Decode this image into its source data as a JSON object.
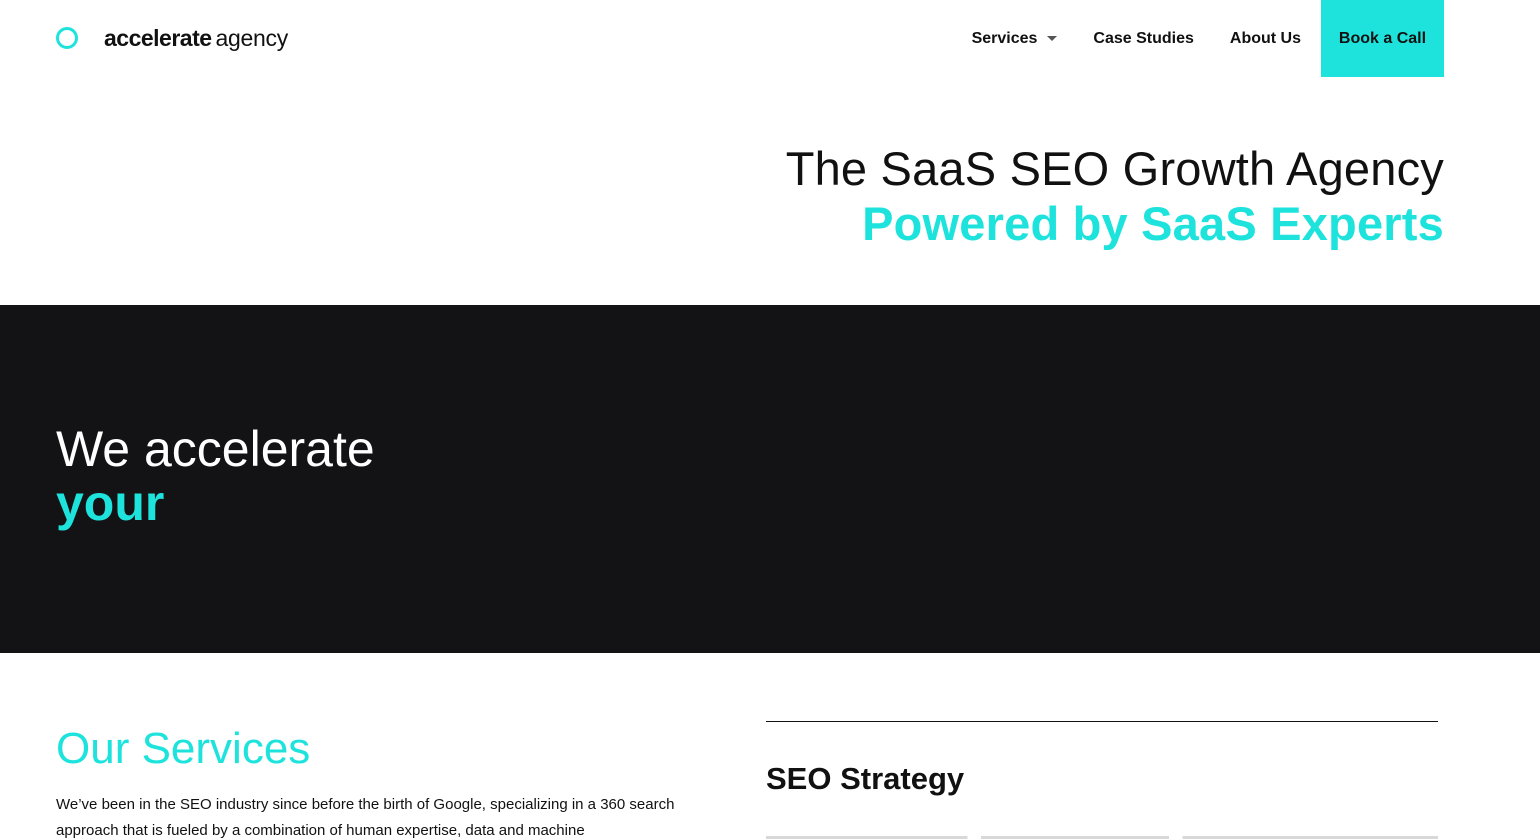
{
  "brand": {
    "name_bold": "accelerate",
    "name_light": "agency",
    "accent_color": "#1ee3dd",
    "dark_color": "#131315",
    "logo_icon": "ring-icon"
  },
  "nav": {
    "items": [
      {
        "label": "Services",
        "has_dropdown": true
      },
      {
        "label": "Case Studies"
      },
      {
        "label": "About Us"
      }
    ],
    "cta_label": "Book a Call"
  },
  "hero": {
    "line1": "The SaaS SEO Growth Agency",
    "line2": "Powered by SaaS Experts"
  },
  "band": {
    "line1": "We accelerate",
    "line2": "your"
  },
  "services": {
    "title": "Our Services",
    "description": "We’ve been in the SEO industry since before the birth of Google, specializing in a 360 search approach that is fueled by a combination of human expertise, data and machine"
  },
  "seo_card": {
    "title": "SEO Strategy"
  }
}
